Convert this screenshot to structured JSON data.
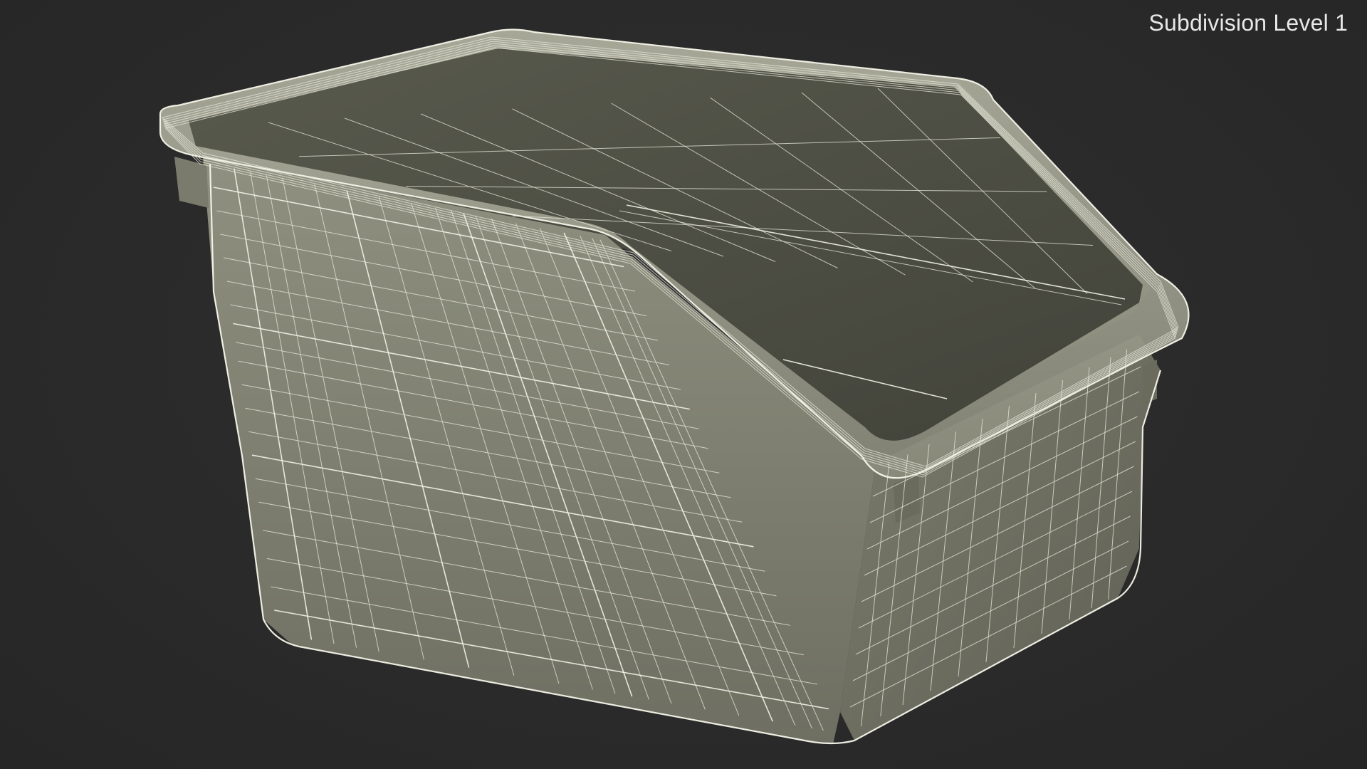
{
  "overlay": {
    "label": "Subdivision Level 1"
  },
  "model": {
    "subject": "crate-wireframe",
    "colors": {
      "background": "#2b2b2b",
      "surface_light": "#8d8e7e",
      "surface_dark": "#5e5f52",
      "wire": "#e9e9dc"
    }
  }
}
